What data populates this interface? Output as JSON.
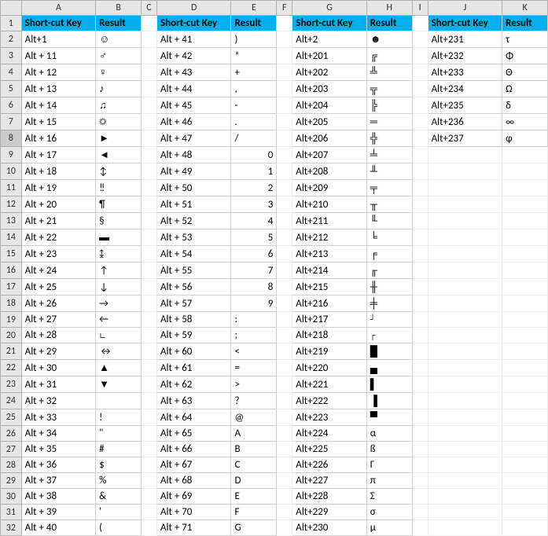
{
  "columns": [
    "A",
    "B",
    "C",
    "D",
    "E",
    "F",
    "G",
    "H",
    "I",
    "J",
    "K"
  ],
  "selected_row": 8,
  "headers": {
    "shortcut": "Short-cut Key",
    "result": "Result"
  },
  "block1": [
    {
      "k": "Alt+1",
      "r": "☺"
    },
    {
      "k": "Alt + 11",
      "r": "♂"
    },
    {
      "k": "Alt + 12",
      "r": "♀"
    },
    {
      "k": "Alt + 13",
      "r": "♪"
    },
    {
      "k": "Alt + 14",
      "r": "♫"
    },
    {
      "k": "Alt + 15",
      "r": "☼"
    },
    {
      "k": "Alt + 16",
      "r": "►"
    },
    {
      "k": "Alt + 17",
      "r": "◄"
    },
    {
      "k": "Alt + 18",
      "r": "↕"
    },
    {
      "k": "Alt + 19",
      "r": "‼"
    },
    {
      "k": "Alt + 20",
      "r": "¶"
    },
    {
      "k": "Alt + 21",
      "r": "§"
    },
    {
      "k": "Alt + 22",
      "r": "▬"
    },
    {
      "k": "Alt + 23",
      "r": "↨"
    },
    {
      "k": "Alt + 24",
      "r": "↑"
    },
    {
      "k": "Alt + 25",
      "r": "↓"
    },
    {
      "k": "Alt + 26",
      "r": "→"
    },
    {
      "k": "Alt + 27",
      "r": "←"
    },
    {
      "k": "Alt + 28",
      "r": "∟"
    },
    {
      "k": "Alt + 29",
      "r": "↔"
    },
    {
      "k": "Alt + 30",
      "r": "▲"
    },
    {
      "k": "Alt + 31",
      "r": "▼"
    },
    {
      "k": "Alt + 32",
      "r": ""
    },
    {
      "k": "Alt + 33",
      "r": "!"
    },
    {
      "k": "Alt + 34",
      "r": "\""
    },
    {
      "k": "Alt + 35",
      "r": "#"
    },
    {
      "k": "Alt + 36",
      "r": "$"
    },
    {
      "k": "Alt + 37",
      "r": "%"
    },
    {
      "k": "Alt + 38",
      "r": "&"
    },
    {
      "k": "Alt + 39",
      "r": "'"
    },
    {
      "k": "Alt + 40",
      "r": "("
    }
  ],
  "block2": [
    {
      "k": "Alt + 41",
      "r": ")"
    },
    {
      "k": "Alt + 42",
      "r": "*"
    },
    {
      "k": "Alt + 43",
      "r": "+"
    },
    {
      "k": "Alt + 44",
      "r": ","
    },
    {
      "k": "Alt + 45",
      "r": "-"
    },
    {
      "k": "Alt + 46",
      "r": "."
    },
    {
      "k": "Alt + 47",
      "r": "/"
    },
    {
      "k": "Alt + 48",
      "r": "0",
      "right": true
    },
    {
      "k": "Alt + 49",
      "r": "1",
      "right": true
    },
    {
      "k": "Alt + 50",
      "r": "2",
      "right": true
    },
    {
      "k": "Alt + 51",
      "r": "3",
      "right": true
    },
    {
      "k": "Alt + 52",
      "r": "4",
      "right": true
    },
    {
      "k": "Alt + 53",
      "r": "5",
      "right": true
    },
    {
      "k": "Alt + 54",
      "r": "6",
      "right": true
    },
    {
      "k": "Alt + 55",
      "r": "7",
      "right": true
    },
    {
      "k": "Alt + 56",
      "r": "8",
      "right": true
    },
    {
      "k": "Alt + 57",
      "r": "9",
      "right": true
    },
    {
      "k": "Alt + 58",
      "r": ":"
    },
    {
      "k": "Alt + 59",
      "r": ";"
    },
    {
      "k": "Alt + 60",
      "r": "<"
    },
    {
      "k": "Alt + 61",
      "r": "="
    },
    {
      "k": "Alt + 62",
      "r": ">"
    },
    {
      "k": "Alt + 63",
      "r": "?"
    },
    {
      "k": "Alt + 64",
      "r": "@"
    },
    {
      "k": "Alt + 65",
      "r": "A"
    },
    {
      "k": "Alt + 66",
      "r": "B"
    },
    {
      "k": "Alt + 67",
      "r": "C"
    },
    {
      "k": "Alt + 68",
      "r": "D"
    },
    {
      "k": "Alt + 69",
      "r": "E"
    },
    {
      "k": "Alt + 70",
      "r": "F"
    },
    {
      "k": "Alt + 71",
      "r": "G"
    }
  ],
  "block3": [
    {
      "k": "Alt+2",
      "r": "☻"
    },
    {
      "k": "Alt+201",
      "r": "╔"
    },
    {
      "k": "Alt+202",
      "r": "╩"
    },
    {
      "k": "Alt+203",
      "r": "╦"
    },
    {
      "k": "Alt+204",
      "r": "╠"
    },
    {
      "k": "Alt+205",
      "r": "═"
    },
    {
      "k": "Alt+206",
      "r": "╬"
    },
    {
      "k": "Alt+207",
      "r": "╧"
    },
    {
      "k": "Alt+208",
      "r": "╨"
    },
    {
      "k": "Alt+209",
      "r": "╤"
    },
    {
      "k": "Alt+210",
      "r": "╥"
    },
    {
      "k": "Alt+211",
      "r": "╙"
    },
    {
      "k": "Alt+212",
      "r": "╘"
    },
    {
      "k": "Alt+213",
      "r": "╒"
    },
    {
      "k": "Alt+214",
      "r": "╓"
    },
    {
      "k": "Alt+215",
      "r": "╫"
    },
    {
      "k": "Alt+216",
      "r": "╪"
    },
    {
      "k": "Alt+217",
      "r": "┘"
    },
    {
      "k": "Alt+218",
      "r": "┌"
    },
    {
      "k": "Alt+219",
      "r": "█"
    },
    {
      "k": "Alt+220",
      "r": "▄"
    },
    {
      "k": "Alt+221",
      "r": "▌"
    },
    {
      "k": "Alt+222",
      "r": "▐"
    },
    {
      "k": "Alt+223",
      "r": "▀"
    },
    {
      "k": "Alt+224",
      "r": "α"
    },
    {
      "k": "Alt+225",
      "r": "ß"
    },
    {
      "k": "Alt+226",
      "r": "Γ"
    },
    {
      "k": "Alt+227",
      "r": "π"
    },
    {
      "k": "Alt+228",
      "r": "Σ"
    },
    {
      "k": "Alt+229",
      "r": "σ"
    },
    {
      "k": "Alt+230",
      "r": "µ"
    }
  ],
  "block4": [
    {
      "k": "Alt+231",
      "r": "τ"
    },
    {
      "k": "Alt+232",
      "r": "Φ"
    },
    {
      "k": "Alt+233",
      "r": "Θ"
    },
    {
      "k": "Alt+234",
      "r": "Ω"
    },
    {
      "k": "Alt+235",
      "r": "δ"
    },
    {
      "k": "Alt+236",
      "r": "∞"
    },
    {
      "k": "Alt+237",
      "r": "φ"
    }
  ]
}
